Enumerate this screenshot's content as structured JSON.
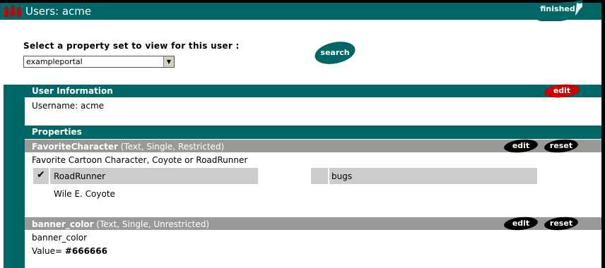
{
  "header": {
    "title": "Users: acme",
    "finished_label": "finished"
  },
  "property_set": {
    "prompt": "Select a property set to view for this user :",
    "selected": "exampleportal",
    "search_label": "search"
  },
  "user_info": {
    "heading": "User Information",
    "edit_label": "edit",
    "username_text": "Username: acme"
  },
  "properties": {
    "heading": "Properties",
    "items": [
      {
        "name": "FavoriteCharacter",
        "meta": " (Text, Single, Restricted)",
        "description": "Favorite Cartoon Character, Coyote or RoadRunner",
        "edit_label": "edit",
        "reset_label": "reset",
        "options": [
          {
            "label": "RoadRunner",
            "selected": true
          },
          {
            "label": "bugs",
            "selected": false
          },
          {
            "label": "Wile E. Coyote",
            "selected": false
          }
        ]
      },
      {
        "name": "banner_color",
        "meta": " (Text, Single, Unrestricted)",
        "description": "banner_color",
        "edit_label": "edit",
        "reset_label": "reset",
        "value_label": "Value= ",
        "value": "#666666"
      }
    ]
  },
  "colors": {
    "teal": "#006666",
    "gray_band": "#999999",
    "red_button": "#cc0000",
    "black_button": "#000000"
  }
}
